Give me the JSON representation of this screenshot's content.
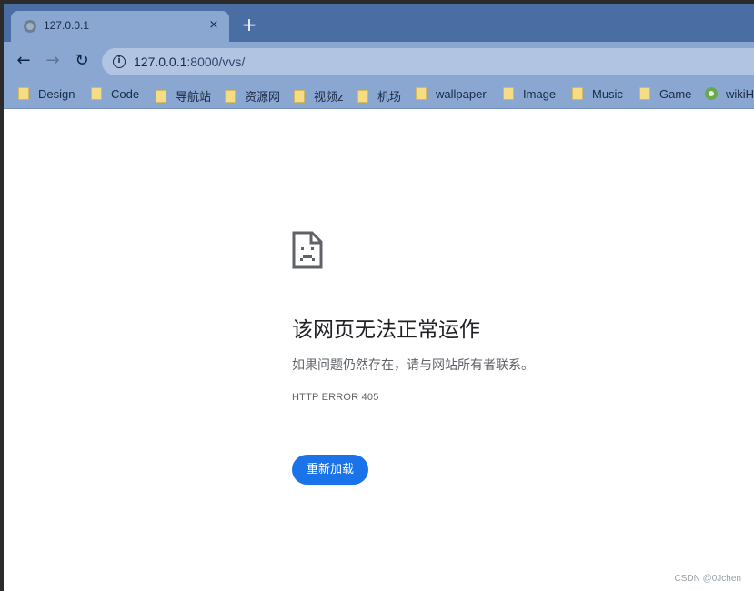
{
  "tab": {
    "title": "127.0.0.1",
    "close_glyph": "×",
    "favicon": "globe-icon"
  },
  "tabstrip": {
    "new_tab_glyph": "+"
  },
  "toolbar": {
    "back_glyph": "←",
    "forward_glyph": "→",
    "reload_glyph": "↻",
    "site_info_glyph": "i",
    "url_host": "127.0.0.1",
    "url_rest": ":8000/vvs/"
  },
  "bookmarks": {
    "items": [
      {
        "label": "Design",
        "icon": "folder-icon"
      },
      {
        "label": "Code",
        "icon": "folder-icon"
      },
      {
        "label": "导航站",
        "icon": "folder-icon"
      },
      {
        "label": "资源网",
        "icon": "folder-icon"
      },
      {
        "label": "视频z",
        "icon": "folder-icon"
      },
      {
        "label": "机场",
        "icon": "folder-icon"
      },
      {
        "label": "wallpaper",
        "icon": "folder-icon"
      },
      {
        "label": "Image",
        "icon": "folder-icon"
      },
      {
        "label": "Music",
        "icon": "folder-icon"
      },
      {
        "label": "Game",
        "icon": "folder-icon"
      },
      {
        "label": "wikiH",
        "icon": "wikihow-icon"
      }
    ]
  },
  "error_page": {
    "icon": "sad-page-icon",
    "title": "该网页无法正常运作",
    "description": "如果问题仍然存在，请与网站所有者联系。",
    "code": "HTTP ERROR 405",
    "reload_label": "重新加载"
  },
  "watermark": "CSDN @0Jchen",
  "colors": {
    "tabstrip": "#4a6ea3",
    "toolbar": "#8aa7d2",
    "omnibox": "#b1c4e2",
    "reload_button": "#1a73e8"
  }
}
